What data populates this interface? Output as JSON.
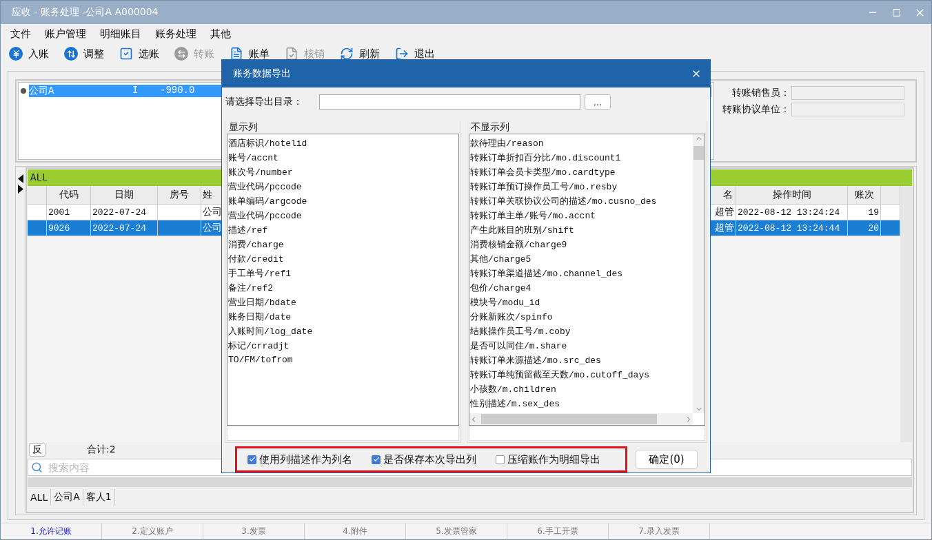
{
  "window": {
    "title": "应收 - 账务处理 -公司A  A000004"
  },
  "menu": [
    "文件",
    "账户管理",
    "明细账目",
    "账务处理",
    "其他"
  ],
  "toolbar": [
    {
      "kind": "yen",
      "label": "入账",
      "disabled": false
    },
    {
      "kind": "adjust",
      "label": "调整",
      "disabled": false
    },
    {
      "kind": "select",
      "label": "选账",
      "disabled": false
    },
    {
      "kind": "transfer",
      "label": "转账",
      "disabled": true
    },
    {
      "kind": "bill",
      "label": "账单",
      "disabled": false
    },
    {
      "kind": "writeoff",
      "label": "核销",
      "disabled": true
    },
    {
      "kind": "refresh",
      "label": "刷新",
      "disabled": false
    },
    {
      "kind": "exit",
      "label": "退出",
      "disabled": false
    }
  ],
  "account_list": {
    "rows": [
      {
        "name": "公司A",
        "type": "I",
        "amount": "-990.0",
        "selected": true
      }
    ]
  },
  "transfer_fields": [
    {
      "label": "转账销售员："
    },
    {
      "label": "转账协议单位："
    }
  ],
  "grid": {
    "group": "ALL",
    "columns": [
      "代码",
      "日期",
      "房号",
      "姓",
      "名",
      "操作时间",
      "账次"
    ],
    "rows": [
      {
        "code": "2001",
        "date": "2022-07-24",
        "name": "公司",
        "operator": "超管",
        "time": "2022-08-12 13:24:24",
        "count": "19",
        "selected": false
      },
      {
        "code": "9026",
        "date": "2022-07-24",
        "name": "公司",
        "operator": "超管",
        "time": "2022-08-12 13:24:44",
        "count": "20",
        "selected": true
      }
    ],
    "invert_button": "反",
    "total": "合计:2",
    "search": {
      "placeholder": "搜索内容"
    },
    "sheet_tabs": [
      "ALL",
      "公司A",
      "客人1"
    ]
  },
  "bottom_tabs": [
    {
      "label": "1.允许记账",
      "selected": true
    },
    {
      "label": "2.定义账户",
      "selected": false
    },
    {
      "label": "3.发票",
      "selected": false
    },
    {
      "label": "4.附件",
      "selected": false
    },
    {
      "label": "5.发票管家",
      "selected": false
    },
    {
      "label": "6.手工开票",
      "selected": false
    },
    {
      "label": "7.录入发票",
      "selected": false
    }
  ],
  "dialog": {
    "title": "账务数据导出",
    "directory_label": "请选择导出目录：",
    "browse_button": "...",
    "shown_columns": {
      "title": "显示列",
      "items": [
        "酒店标识/hotelid",
        "账号/accnt",
        "账次号/number",
        "营业代码/pccode",
        "账单编码/argcode",
        "营业代码/pccode",
        "描述/ref",
        "消费/charge",
        "付款/credit",
        "手工单号/ref1",
        "备注/ref2",
        "营业日期/bdate",
        "账务日期/date",
        "入账时间/log_date",
        "标记/crradjt",
        "TO/FM/tofrom"
      ]
    },
    "hidden_columns": {
      "title": "不显示列",
      "items": [
        "款待理由/reason",
        "转账订单折扣百分比/mo.discount1",
        "转账订单会员卡类型/mo.cardtype",
        "转账订单预订操作员工号/mo.resby",
        "转账订单关联协议公司的描述/mo.cusno_des",
        "转账订单主单/账号/mo.accnt",
        "产生此账目的班别/shift",
        "消费核销金额/charge9",
        "其他/charge5",
        "转账订单渠道描述/mo.channel_des",
        "包价/charge4",
        "模块号/modu_id",
        "分账新账次/spinfo",
        "结账操作员工号/m.coby",
        "是否可以同住/m.share",
        "转账订单来源描述/mo.src_des",
        "转账订单纯预留截至天数/mo.cutoff_days",
        "小孩数/m.children",
        "性别描述/m.sex_des"
      ]
    },
    "options": [
      {
        "label": "使用列描述作为列名",
        "checked": true
      },
      {
        "label": "是否保存本次导出列",
        "checked": true
      },
      {
        "label": "压缩账作为明细导出",
        "checked": false
      }
    ],
    "ok_button": "确定(0)"
  }
}
